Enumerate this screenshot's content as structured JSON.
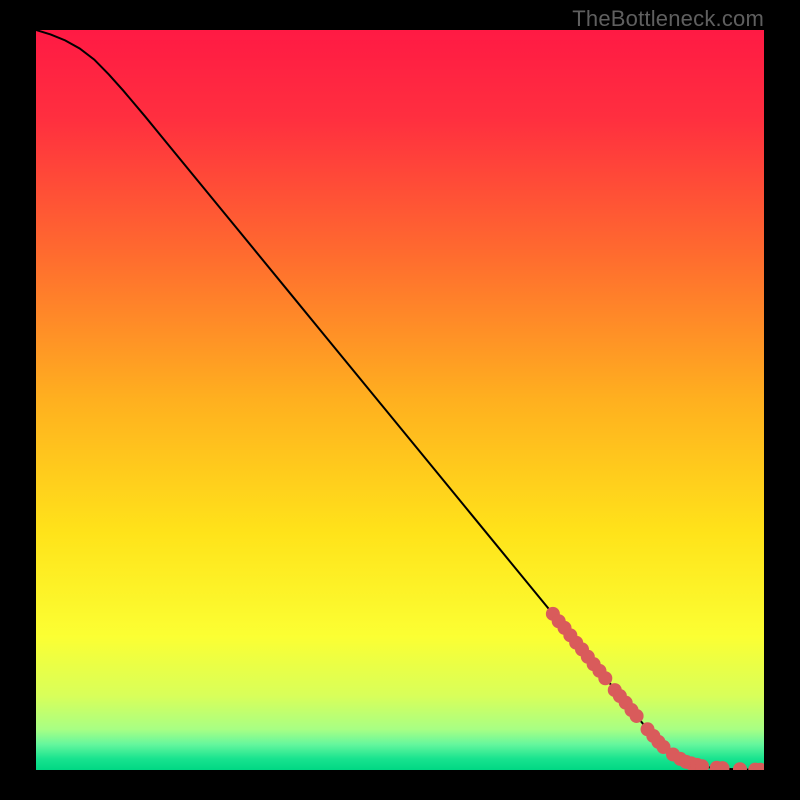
{
  "watermark": "TheBottleneck.com",
  "colors": {
    "gradient_stops": [
      {
        "offset": 0.0,
        "color": "#ff1a44"
      },
      {
        "offset": 0.12,
        "color": "#ff2f3f"
      },
      {
        "offset": 0.3,
        "color": "#ff6a2f"
      },
      {
        "offset": 0.5,
        "color": "#ffb01f"
      },
      {
        "offset": 0.68,
        "color": "#ffe31a"
      },
      {
        "offset": 0.82,
        "color": "#fbff33"
      },
      {
        "offset": 0.9,
        "color": "#d8ff5a"
      },
      {
        "offset": 0.945,
        "color": "#a8ff84"
      },
      {
        "offset": 0.965,
        "color": "#66f79d"
      },
      {
        "offset": 0.985,
        "color": "#18e38f"
      },
      {
        "offset": 1.0,
        "color": "#00d884"
      }
    ],
    "curve": "#000000",
    "marker": "#d95b5b"
  },
  "chart_data": {
    "type": "line",
    "title": "",
    "xlabel": "",
    "ylabel": "",
    "xlim": [
      0,
      100
    ],
    "ylim": [
      0,
      100
    ],
    "series": [
      {
        "name": "bottleneck-curve",
        "x": [
          0,
          2,
          4,
          6,
          8,
          10,
          12,
          15,
          18,
          22,
          26,
          30,
          35,
          40,
          45,
          50,
          55,
          60,
          65,
          70,
          75,
          80,
          82,
          84,
          86,
          88,
          90,
          92,
          94,
          96,
          98,
          100
        ],
        "y": [
          100,
          99.4,
          98.6,
          97.5,
          96.0,
          94.0,
          91.8,
          88.3,
          84.7,
          79.9,
          75.1,
          70.3,
          64.3,
          58.3,
          52.3,
          46.3,
          40.3,
          34.3,
          28.3,
          22.3,
          16.3,
          10.3,
          7.9,
          5.5,
          3.4,
          1.8,
          0.9,
          0.4,
          0.2,
          0.1,
          0.05,
          0.03
        ]
      }
    ],
    "markers": {
      "name": "sample-points",
      "points": [
        {
          "x": 71.0,
          "y": 21.1
        },
        {
          "x": 71.8,
          "y": 20.1
        },
        {
          "x": 72.6,
          "y": 19.2
        },
        {
          "x": 73.4,
          "y": 18.2
        },
        {
          "x": 74.2,
          "y": 17.2
        },
        {
          "x": 75.0,
          "y": 16.3
        },
        {
          "x": 75.8,
          "y": 15.3
        },
        {
          "x": 76.6,
          "y": 14.3
        },
        {
          "x": 77.4,
          "y": 13.4
        },
        {
          "x": 78.2,
          "y": 12.4
        },
        {
          "x": 79.5,
          "y": 10.8
        },
        {
          "x": 80.2,
          "y": 10.0
        },
        {
          "x": 81.0,
          "y": 9.1
        },
        {
          "x": 81.8,
          "y": 8.1
        },
        {
          "x": 82.5,
          "y": 7.3
        },
        {
          "x": 84.0,
          "y": 5.5
        },
        {
          "x": 84.8,
          "y": 4.6
        },
        {
          "x": 85.5,
          "y": 3.8
        },
        {
          "x": 86.2,
          "y": 3.1
        },
        {
          "x": 87.5,
          "y": 2.1
        },
        {
          "x": 88.5,
          "y": 1.5
        },
        {
          "x": 89.3,
          "y": 1.1
        },
        {
          "x": 90.0,
          "y": 0.9
        },
        {
          "x": 90.8,
          "y": 0.7
        },
        {
          "x": 91.5,
          "y": 0.5
        },
        {
          "x": 93.5,
          "y": 0.3
        },
        {
          "x": 94.3,
          "y": 0.25
        },
        {
          "x": 96.7,
          "y": 0.1
        },
        {
          "x": 98.8,
          "y": 0.05
        },
        {
          "x": 99.5,
          "y": 0.04
        }
      ]
    }
  }
}
